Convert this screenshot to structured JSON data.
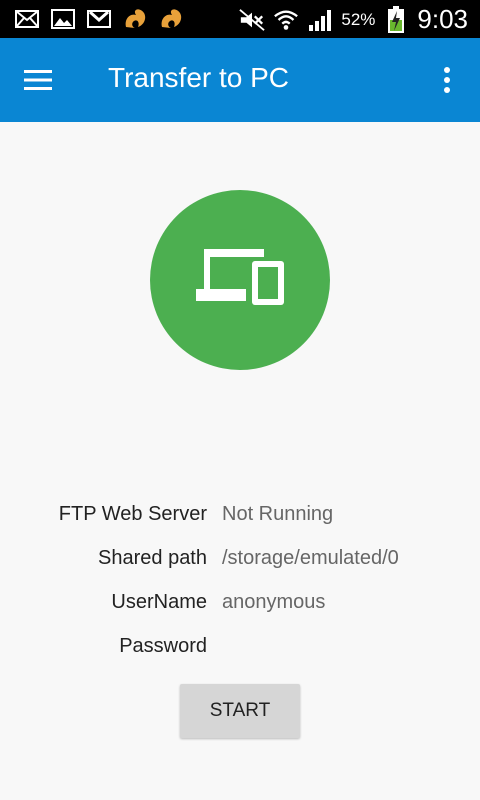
{
  "status_bar": {
    "icons_left": [
      "mail-icon",
      "image-icon",
      "gmail-icon",
      "uc-browser-icon",
      "uc-browser-icon"
    ],
    "icons_right": [
      "mute-icon",
      "wifi-icon",
      "signal-icon"
    ],
    "battery_percent": "52%",
    "time": "9:03"
  },
  "app_bar": {
    "title": "Transfer to PC",
    "menu_icon": "hamburger-icon",
    "overflow_icon": "more-vert-icon",
    "color": "#0a86d3"
  },
  "hero": {
    "icon": "devices-icon",
    "color": "#4caf50"
  },
  "info": {
    "ftp_label": "FTP Web Server",
    "ftp_value": "Not Running",
    "path_label": "Shared path",
    "path_value": "/storage/emulated/0",
    "user_label": "UserName",
    "user_value": "anonymous",
    "password_label": "Password",
    "password_value": ""
  },
  "actions": {
    "start_label": "START"
  }
}
